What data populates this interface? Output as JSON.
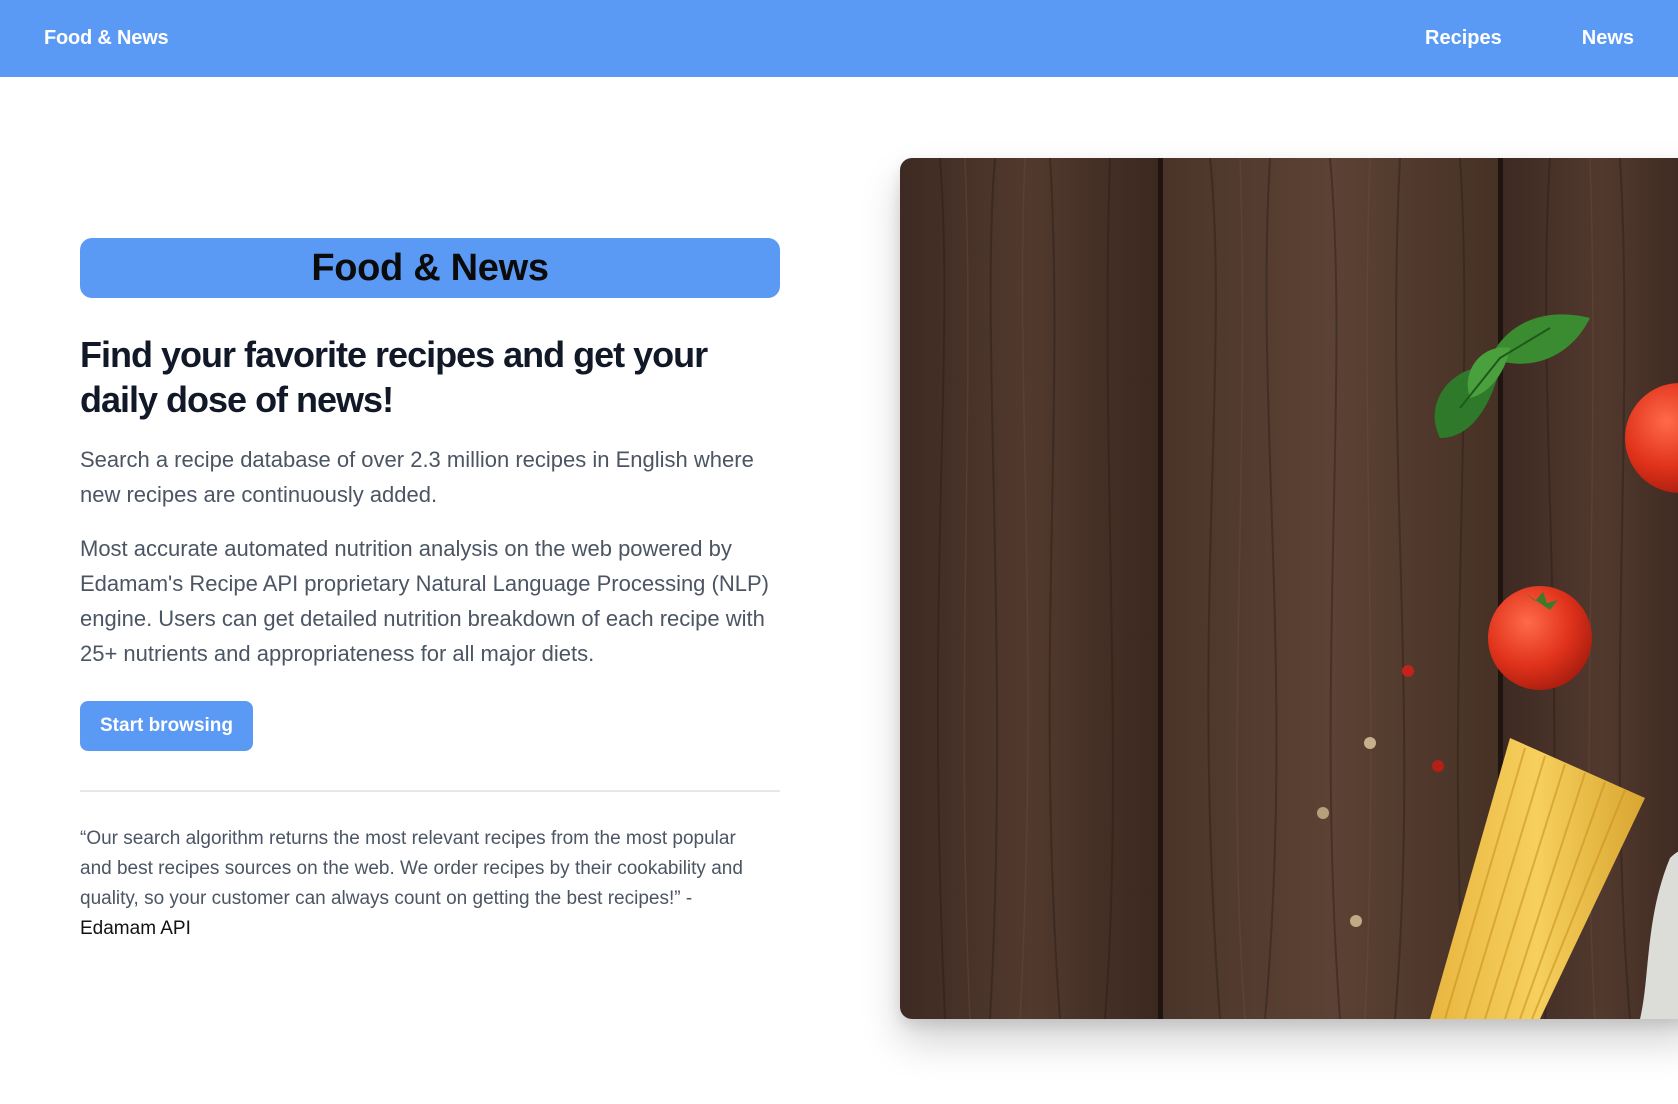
{
  "navbar": {
    "brand": "Food & News",
    "links": [
      {
        "label": "Recipes"
      },
      {
        "label": "News"
      }
    ]
  },
  "hero": {
    "badge_title": "Food & News",
    "headline": "Find your favorite recipes and get your daily dose of news!",
    "paragraph_1": "Search a recipe database of over 2.3 million recipes in English where new recipes are continuously added.",
    "paragraph_2": "Most accurate automated nutrition analysis on the web powered by Edamam's Recipe API proprietary Natural Language Processing (NLP) engine. Users can get detailed nutrition breakdown of each recipe with 25+ nutrients and appropriateness for all major diets.",
    "cta_label": "Start browsing",
    "quote_text": "“Our search algorithm returns the most relevant recipes from the most popular and best recipes sources on the web. We order recipes by their cookability and quality, so your customer can always count on getting the best recipes!” - ",
    "quote_author": "Edamam API"
  },
  "colors": {
    "accent": "#5b9af4",
    "text_dark": "#111827",
    "text_muted": "#4b5563",
    "divider": "#e5e7eb",
    "wood": "#4a3228"
  },
  "image": {
    "subject": "hero-photo-pasta-tomatoes-basil-on-wood"
  }
}
